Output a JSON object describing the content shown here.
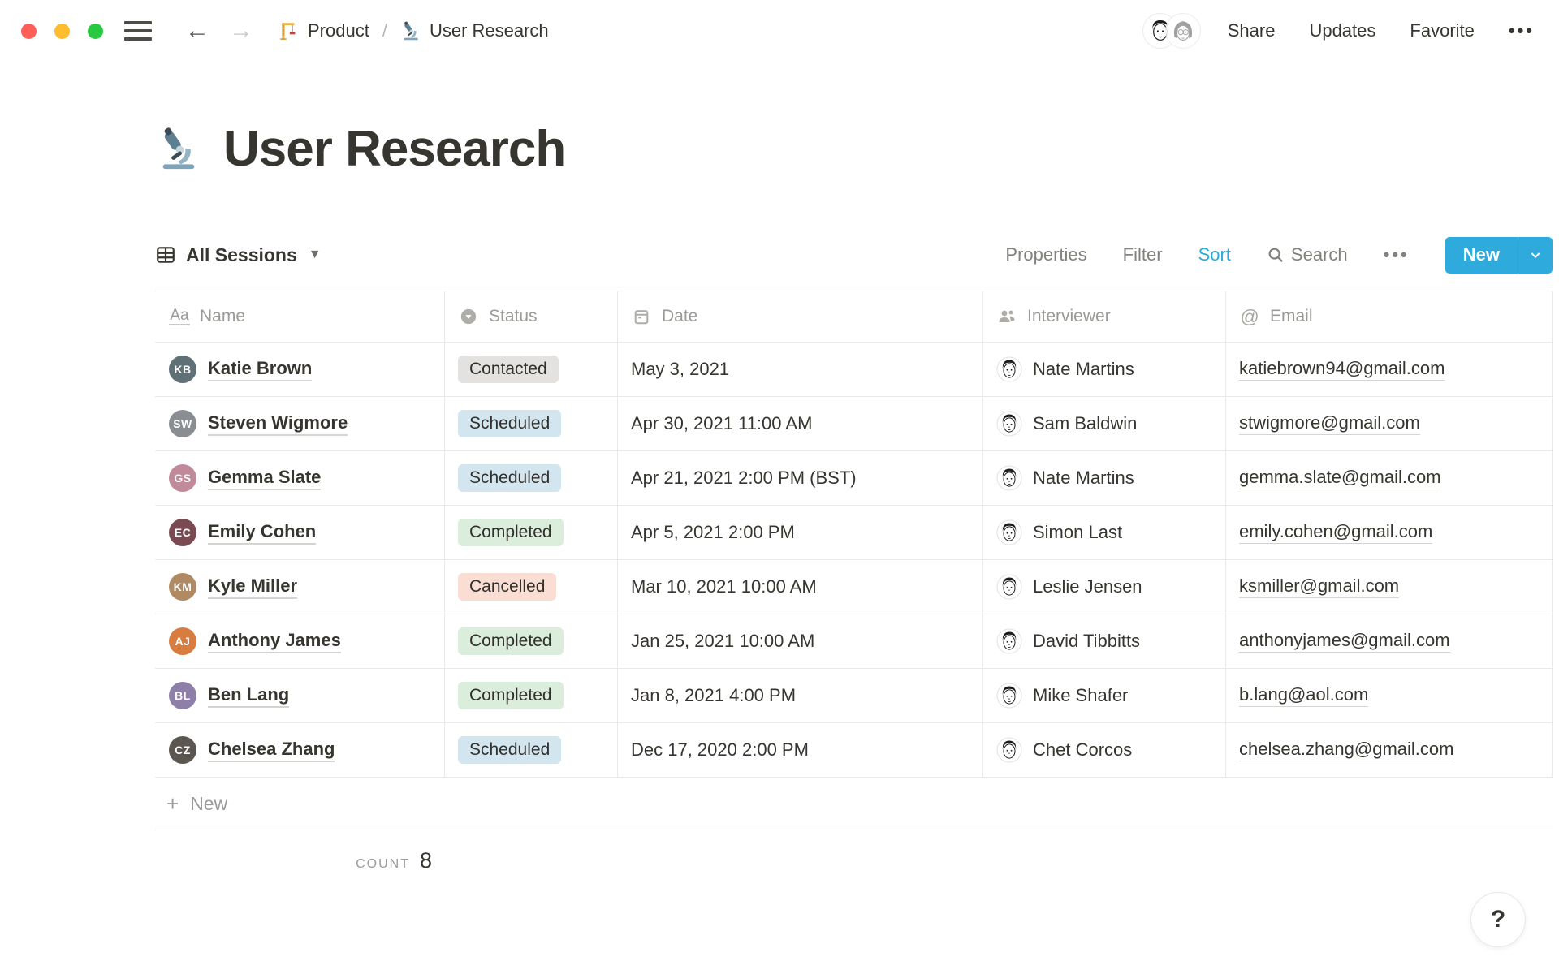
{
  "window": {
    "breadcrumb": {
      "items": [
        {
          "icon": "construction-crane",
          "label": "Product"
        },
        {
          "icon": "microscope",
          "label": "User Research"
        }
      ],
      "separator": "/"
    },
    "actions": {
      "share": "Share",
      "updates": "Updates",
      "favorite": "Favorite",
      "more": "•••"
    }
  },
  "page": {
    "icon": "microscope",
    "title": "User Research"
  },
  "view_bar": {
    "view": {
      "icon": "table-view",
      "label": "All Sessions"
    },
    "menu": {
      "properties": "Properties",
      "filter": "Filter",
      "sort": "Sort",
      "search": "Search",
      "more": "•••"
    },
    "active_item": "Sort",
    "new_button": {
      "label": "New",
      "caret": "⌄"
    }
  },
  "table": {
    "columns": [
      {
        "icon": "text-type-icon",
        "label": "Name"
      },
      {
        "icon": "select-icon",
        "label": "Status"
      },
      {
        "icon": "calendar-icon",
        "label": "Date"
      },
      {
        "icon": "person-icon",
        "label": "Interviewer"
      },
      {
        "icon": "at-email-icon",
        "label": "Email"
      }
    ],
    "rows": [
      {
        "name": "Katie Brown",
        "status": "Contacted",
        "status_color": "gray",
        "date": "May 3, 2021",
        "interviewer": "Nate Martins",
        "email": "katiebrown94@gmail.com",
        "avatar_color": "#5f7077"
      },
      {
        "name": "Steven Wigmore",
        "status": "Scheduled",
        "status_color": "blue",
        "date": "Apr 30, 2021 11:00 AM",
        "interviewer": "Sam Baldwin",
        "email": "stwigmore@gmail.com",
        "avatar_color": "#8a8d91"
      },
      {
        "name": "Gemma Slate",
        "status": "Scheduled",
        "status_color": "blue",
        "date": "Apr 21, 2021 2:00 PM (BST)",
        "interviewer": "Nate Martins",
        "email": "gemma.slate@gmail.com",
        "avatar_color": "#c08a9b"
      },
      {
        "name": "Emily Cohen",
        "status": "Completed",
        "status_color": "green",
        "date": "Apr 5, 2021 2:00 PM",
        "interviewer": "Simon Last",
        "email": "emily.cohen@gmail.com",
        "avatar_color": "#7a4a52"
      },
      {
        "name": "Kyle Miller",
        "status": "Cancelled",
        "status_color": "red",
        "date": "Mar 10, 2021 10:00 AM",
        "interviewer": "Leslie Jensen",
        "email": "ksmiller@gmail.com",
        "avatar_color": "#b08a62"
      },
      {
        "name": "Anthony James",
        "status": "Completed",
        "status_color": "green",
        "date": "Jan 25, 2021 10:00 AM",
        "interviewer": "David Tibbitts",
        "email": "anthonyjames@gmail.com",
        "avatar_color": "#d97c3f"
      },
      {
        "name": "Ben Lang",
        "status": "Completed",
        "status_color": "green",
        "date": "Jan 8, 2021 4:00 PM",
        "interviewer": "Mike Shafer",
        "email": "b.lang@aol.com",
        "avatar_color": "#8d7fa8"
      },
      {
        "name": "Chelsea Zhang",
        "status": "Scheduled",
        "status_color": "blue",
        "date": "Dec 17, 2020 2:00 PM",
        "interviewer": "Chet Corcos",
        "email": "chelsea.zhang@gmail.com",
        "avatar_color": "#5b5650"
      }
    ],
    "new_row_label": "New",
    "count_label": "COUNT",
    "count_value": "8"
  },
  "help": {
    "label": "?"
  },
  "colors": {
    "accent_blue": "#2EAADC",
    "text": "#37352F",
    "muted_text": "#9B9A97",
    "border": "#E9E9E7",
    "pill_gray": "#E3E2E0",
    "pill_blue": "#D3E5EF",
    "pill_green": "#DBEDDB",
    "pill_red": "#FBDED3",
    "traffic_red": "#FF5F57",
    "traffic_yellow": "#FEBC2E",
    "traffic_green": "#28C840"
  }
}
